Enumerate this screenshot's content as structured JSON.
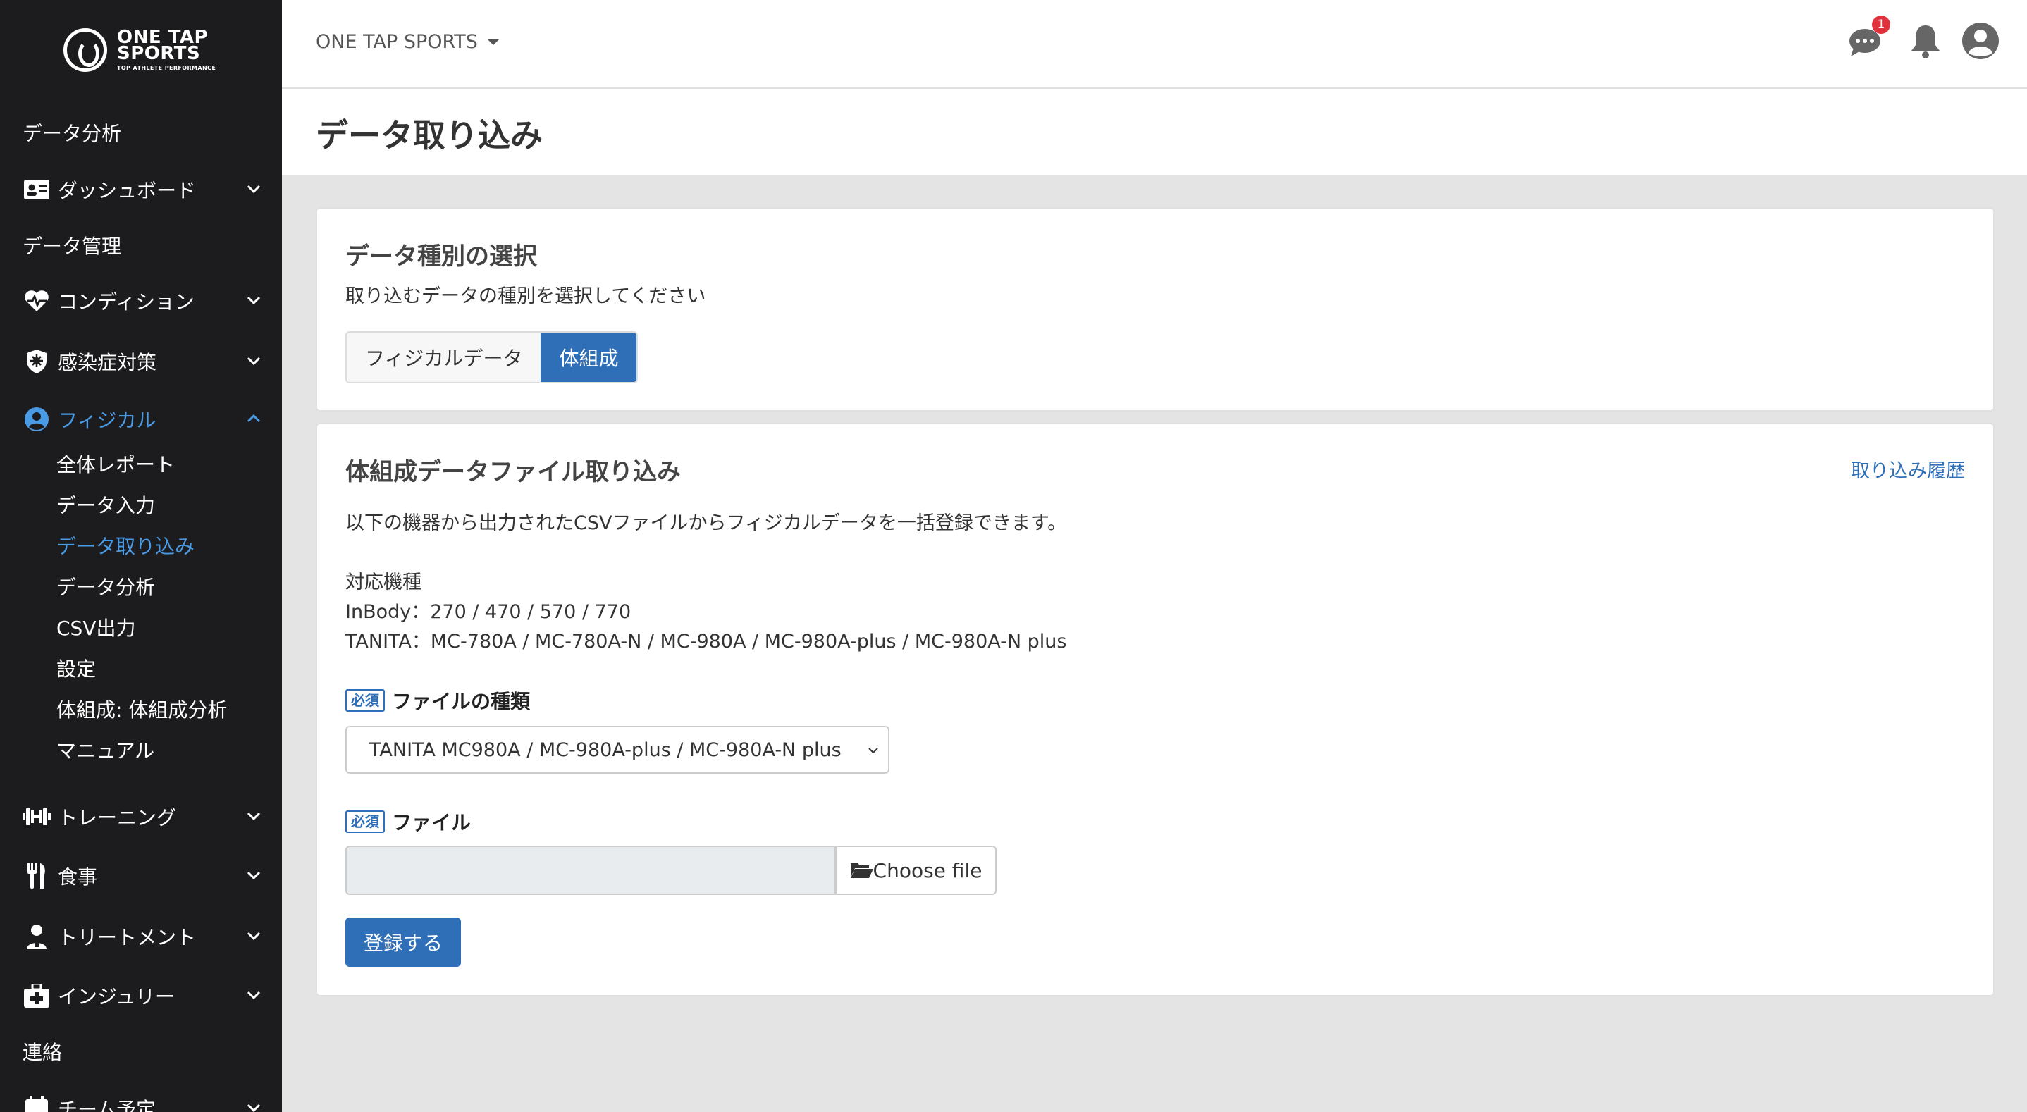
{
  "brand": {
    "line1": "ONE TAP",
    "line2": "SPORTS",
    "tagline": "TOP ATHLETE PERFORMANCE"
  },
  "header": {
    "team": "ONE TAP SPORTS",
    "chat_badge": "1"
  },
  "sidebar": {
    "section_analysis": "データ分析",
    "dashboard": "ダッシュボード",
    "section_manage": "データ管理",
    "condition": "コンディション",
    "infection": "感染症対策",
    "physical": "フィジカル",
    "sub": [
      "全体レポート",
      "データ入力",
      "データ取り込み",
      "データ分析",
      "CSV出力",
      "設定",
      "体組成: 体組成分析",
      "マニュアル"
    ],
    "training": "トレーニング",
    "meal": "食事",
    "treatment": "トリートメント",
    "injury": "インジュリー",
    "section_contact": "連絡",
    "schedule": "チーム予定"
  },
  "page": {
    "title": "データ取り込み"
  },
  "type_card": {
    "title": "データ種別の選択",
    "desc": "取り込むデータの種別を選択してください",
    "options": [
      "フィジカルデータ",
      "体組成"
    ],
    "selected": "体組成"
  },
  "import_card": {
    "title": "体組成データファイル取り込み",
    "history_link": "取り込み履歴",
    "desc": "以下の機器から出力されたCSVファイルからフィジカルデータを一括登録できます。",
    "supported_heading": "対応機種",
    "supported_inbody": "InBody：270 / 470 / 570 / 770",
    "supported_tanita": "TANITA：MC-780A / MC-780A-N / MC-980A / MC-980A-plus / MC-980A-N plus",
    "required_tag": "必須",
    "file_type_label": "ファイルの種類",
    "file_type_value": "TANITA MC980A / MC-980A-plus / MC-980A-N plus",
    "file_label": "ファイル",
    "choose_file": "Choose file",
    "submit": "登録する"
  }
}
